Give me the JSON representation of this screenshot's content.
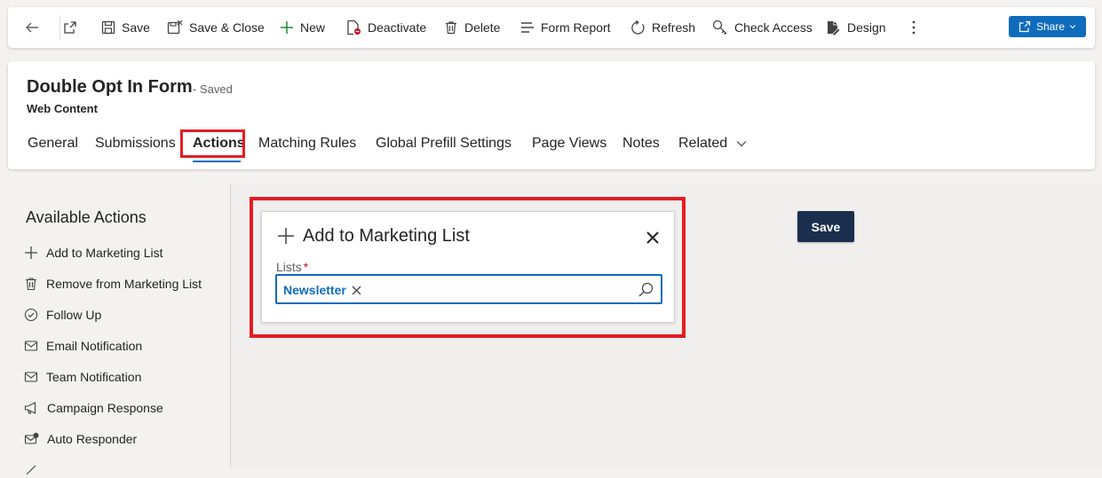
{
  "toolbar": {
    "save": "Save",
    "save_close": "Save & Close",
    "new": "New",
    "deactivate": "Deactivate",
    "delete": "Delete",
    "form_report": "Form Report",
    "refresh": "Refresh",
    "check_access": "Check Access",
    "design": "Design",
    "share": "Share",
    "accent": "#0f6cbd"
  },
  "header": {
    "title": "Double Opt In Form",
    "status": "- Saved",
    "entity": "Web Content",
    "tabs": [
      "General",
      "Submissions",
      "Actions",
      "Matching Rules",
      "Global Prefill Settings",
      "Page Views",
      "Notes",
      "Related"
    ],
    "active_tab": "Actions"
  },
  "sidebar": {
    "title": "Available Actions",
    "items": [
      {
        "label": "Add to Marketing List",
        "icon": "plus-icon"
      },
      {
        "label": "Remove from Marketing List",
        "icon": "trash-icon"
      },
      {
        "label": "Follow Up",
        "icon": "check-circle-icon"
      },
      {
        "label": "Email Notification",
        "icon": "mail-icon"
      },
      {
        "label": "Team Notification",
        "icon": "mail-icon"
      },
      {
        "label": "Campaign Response",
        "icon": "megaphone-icon"
      },
      {
        "label": "Auto Responder",
        "icon": "mail-reply-icon"
      }
    ]
  },
  "dialog": {
    "title": "Add to Marketing List",
    "lists_label": "Lists",
    "required_marker": "*",
    "selected_tags": [
      "Newsletter"
    ]
  },
  "main": {
    "save_label": "Save"
  }
}
